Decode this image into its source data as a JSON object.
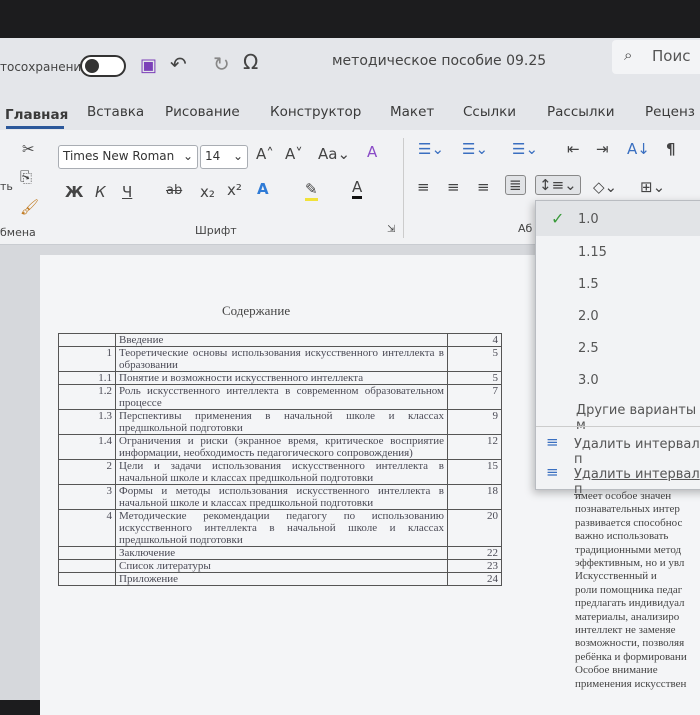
{
  "titlebar": {
    "autosave_label": "тосохранение",
    "doc_title": "методическое пособие 09.25",
    "search_placeholder": "Поис"
  },
  "tabs": [
    "Главная",
    "Вставка",
    "Рисование",
    "Конструктор",
    "Макет",
    "Ссылки",
    "Рассылки",
    "Реценз"
  ],
  "ribbon": {
    "font_name": "Times New Roman",
    "font_size": "14",
    "paste_label": "ть",
    "clipboard_group": "бмена",
    "font_group": "Шрифт",
    "paragraph_group": "Аб",
    "bold": "Ж",
    "italic": "К",
    "underline": "Ч",
    "strike": "ab",
    "case": "Aa"
  },
  "line_spacing_menu": {
    "options": [
      "1.0",
      "1.15",
      "1.5",
      "2.0",
      "2.5",
      "3.0"
    ],
    "selected": "1.0",
    "more": "Другие варианты м",
    "remove_before": "Удалить интервал п",
    "remove_after": "Удалить интервал п"
  },
  "document": {
    "heading": "Содержание",
    "toc": [
      {
        "num": "",
        "text": "Введение",
        "page": "4"
      },
      {
        "num": "1",
        "text": "Теоретические основы использования искусственного интеллекта в образовании",
        "page": "5"
      },
      {
        "num": "1.1",
        "text": "Понятие и возможности искусственного интеллекта",
        "page": "5"
      },
      {
        "num": "1.2",
        "text": "Роль искусственного интеллекта в современном образовательном процессе",
        "page": "7"
      },
      {
        "num": "1.3",
        "text": "Перспективы применения в начальной школе и классах предшкольной подготовки",
        "page": "9"
      },
      {
        "num": "1.4",
        "text": "Ограничения и риски (экранное время, критическое восприятие информации, необходимость педагогического сопровождения)",
        "page": "12"
      },
      {
        "num": "2",
        "text": "Цели и задачи использования искусственного интеллекта в начальной школе и классах предшкольной подготовки",
        "page": "15"
      },
      {
        "num": "3",
        "text": "Формы и методы использования искусственного интеллекта в начальной школе и классах предшкольной подготовки",
        "page": "18"
      },
      {
        "num": "4",
        "text": "Методические рекомендации педагогу по использованию искусственного интеллекта в начальной школе и классах предшкольной подготовки",
        "page": "20"
      },
      {
        "num": "",
        "text": "Заключение",
        "page": "22"
      },
      {
        "num": "",
        "text": "Список литературы",
        "page": "23"
      },
      {
        "num": "",
        "text": "Приложение",
        "page": "24"
      }
    ],
    "body_lines": [
      "имеет особое значен",
      "познавательных интер",
      "развивается способнос",
      "важно использовать",
      "традиционными метод",
      "эффективным, но и увл",
      "    Искусственный и",
      "роли помощника педаг",
      "предлагать индивидуал",
      "материалы, анализиро",
      "интеллект не заменяе",
      "возможности, позволяя",
      "ребёнка и формировани",
      "    Особое внимание",
      "применения искусствен"
    ]
  }
}
